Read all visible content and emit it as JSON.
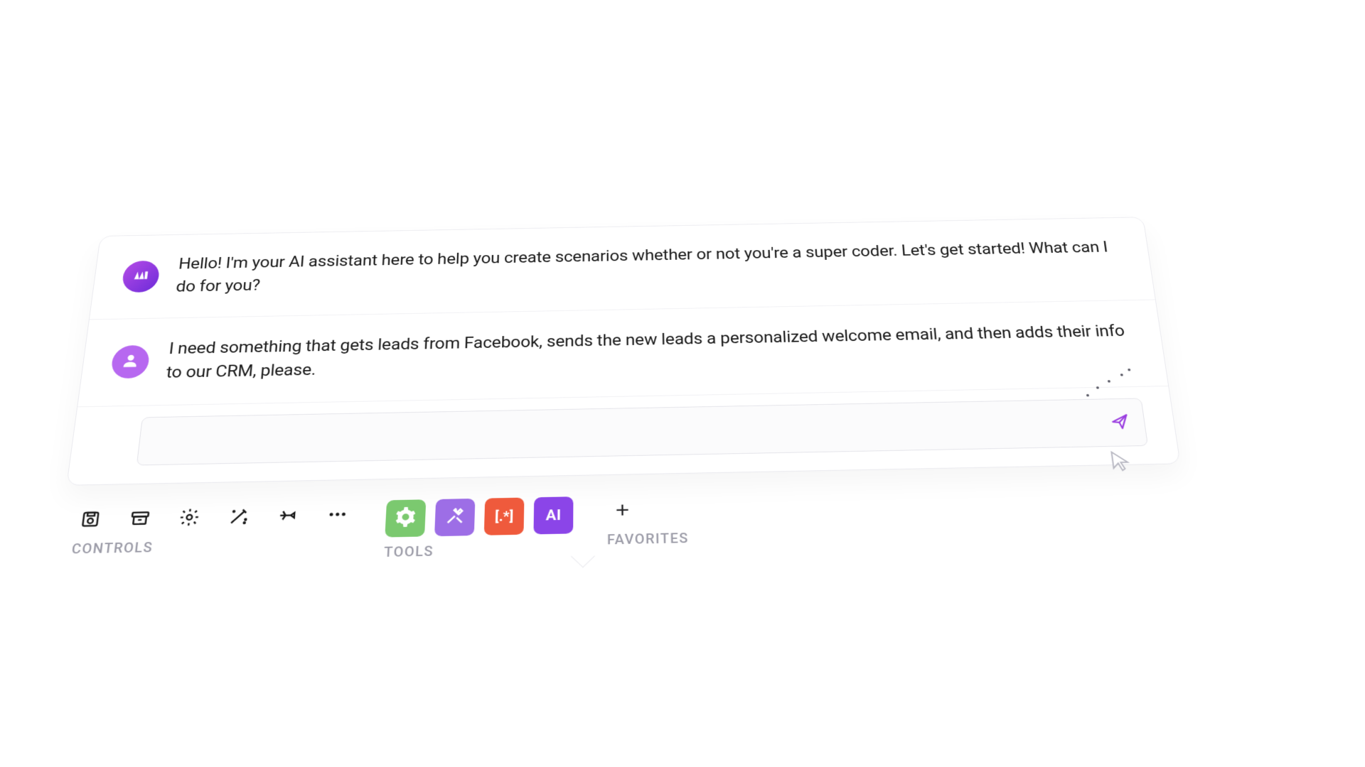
{
  "chat": {
    "messages": [
      {
        "role": "assistant",
        "text": "Hello! I'm your AI assistant here to help you create scenarios whether or not you're a super coder. Let's get started! What can I do for you?"
      },
      {
        "role": "user",
        "text": "I need something that gets leads from Facebook, sends the new leads a personalized welcome email, and then adds their info to our CRM, please."
      }
    ],
    "input": {
      "value": "",
      "placeholder": ""
    }
  },
  "toolbar": {
    "controls_label": "CONTROLS",
    "tools_label": "TOOLS",
    "favorites_label": "FAVORITES",
    "ai_tile_label": "AI",
    "orange_tile_label": "[.*]",
    "favorites_add": "+"
  }
}
